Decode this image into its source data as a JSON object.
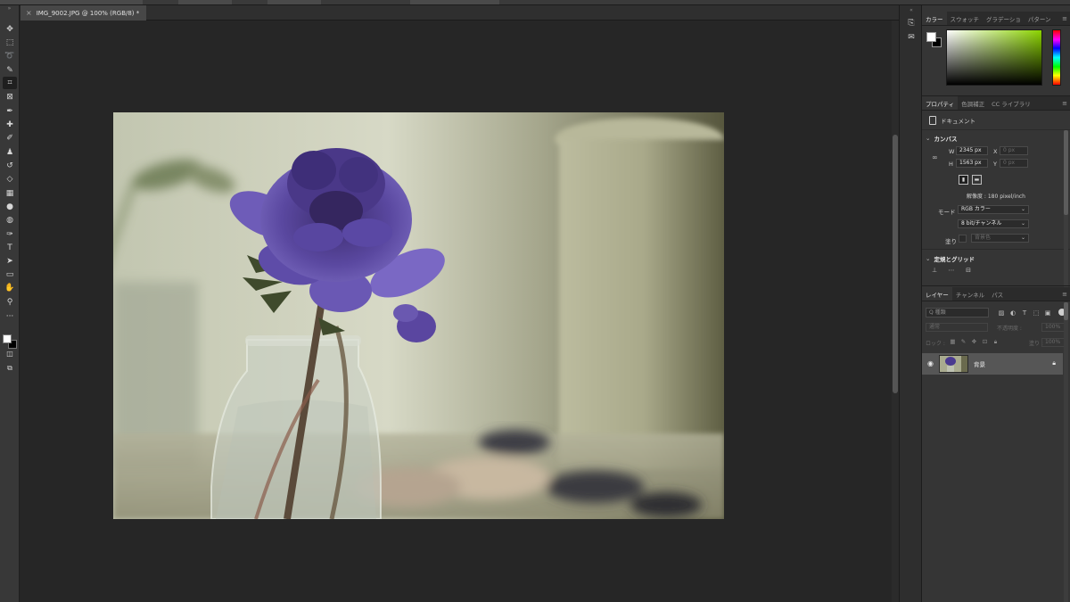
{
  "document_tab": {
    "title": "IMG_9002.JPG @ 100% (RGB/8) *",
    "close_icon": "close-icon"
  },
  "toolbar": {
    "tools": [
      {
        "name": "move-tool-icon",
        "glyph": "✥"
      },
      {
        "name": "marquee-tool-icon",
        "glyph": "⬚"
      },
      {
        "name": "lasso-tool-icon",
        "glyph": "➰"
      },
      {
        "name": "quick-select-tool-icon",
        "glyph": "✎"
      },
      {
        "name": "crop-tool-icon",
        "glyph": "⌗"
      },
      {
        "name": "frame-tool-icon",
        "glyph": "⊠"
      },
      {
        "name": "eyedropper-tool-icon",
        "glyph": "✒"
      },
      {
        "name": "healing-brush-tool-icon",
        "glyph": "✚"
      },
      {
        "name": "brush-tool-icon",
        "glyph": "✐"
      },
      {
        "name": "clone-stamp-tool-icon",
        "glyph": "♟"
      },
      {
        "name": "history-brush-tool-icon",
        "glyph": "↺"
      },
      {
        "name": "eraser-tool-icon",
        "glyph": "◇"
      },
      {
        "name": "gradient-tool-icon",
        "glyph": "▦"
      },
      {
        "name": "blur-tool-icon",
        "glyph": "●"
      },
      {
        "name": "dodge-tool-icon",
        "glyph": "◍"
      },
      {
        "name": "pen-tool-icon",
        "glyph": "✑"
      },
      {
        "name": "type-tool-icon",
        "glyph": "T"
      },
      {
        "name": "path-select-tool-icon",
        "glyph": "➤"
      },
      {
        "name": "shape-tool-icon",
        "glyph": "▭"
      },
      {
        "name": "hand-tool-icon",
        "glyph": "✋"
      },
      {
        "name": "zoom-tool-icon",
        "glyph": "⚲"
      },
      {
        "name": "more-tools-icon",
        "glyph": "···"
      }
    ],
    "colors": {
      "foreground": "#ffffff",
      "background": "#000000"
    }
  },
  "color_panel": {
    "tabs": [
      "カラー",
      "スウォッチ",
      "グラデーショ",
      "パターン"
    ],
    "active_tab": 0,
    "foreground": "#ffffff",
    "background": "#000000",
    "hue_color": "#8cd400"
  },
  "properties_panel": {
    "tabs": [
      "プロパティ",
      "色調補正",
      "CC ライブラリ"
    ],
    "active_tab": 0,
    "document_label": "ドキュメント",
    "canvas": {
      "section_title": "カンバス",
      "w_label": "W",
      "h_label": "H",
      "x_label": "X",
      "y_label": "Y",
      "width": "2345 px",
      "height": "1563 px",
      "x_placeholder": "0 px",
      "y_placeholder": "0 px",
      "resolution": "解像度 : 180 pixel/inch",
      "mode_label": "モード",
      "mode": "RGB カラー",
      "bit_depth": "8 bit/チャンネル",
      "fill_label": "塗り",
      "fill_value": "背景色"
    },
    "rulers_grids": {
      "section_title": "定規とグリッド"
    }
  },
  "layers_panel": {
    "tabs": [
      "レイヤー",
      "チャンネル",
      "パス"
    ],
    "active_tab": 0,
    "search_placeholder": "Q 種類",
    "blend_mode": "通常",
    "opacity_label": "不透明度 :",
    "opacity_value": "100%",
    "lock_label": "ロック :",
    "fill_label": "塗り :",
    "fill_value": "100%",
    "layers": [
      {
        "name": "背景",
        "visible": true,
        "locked": true
      }
    ]
  }
}
